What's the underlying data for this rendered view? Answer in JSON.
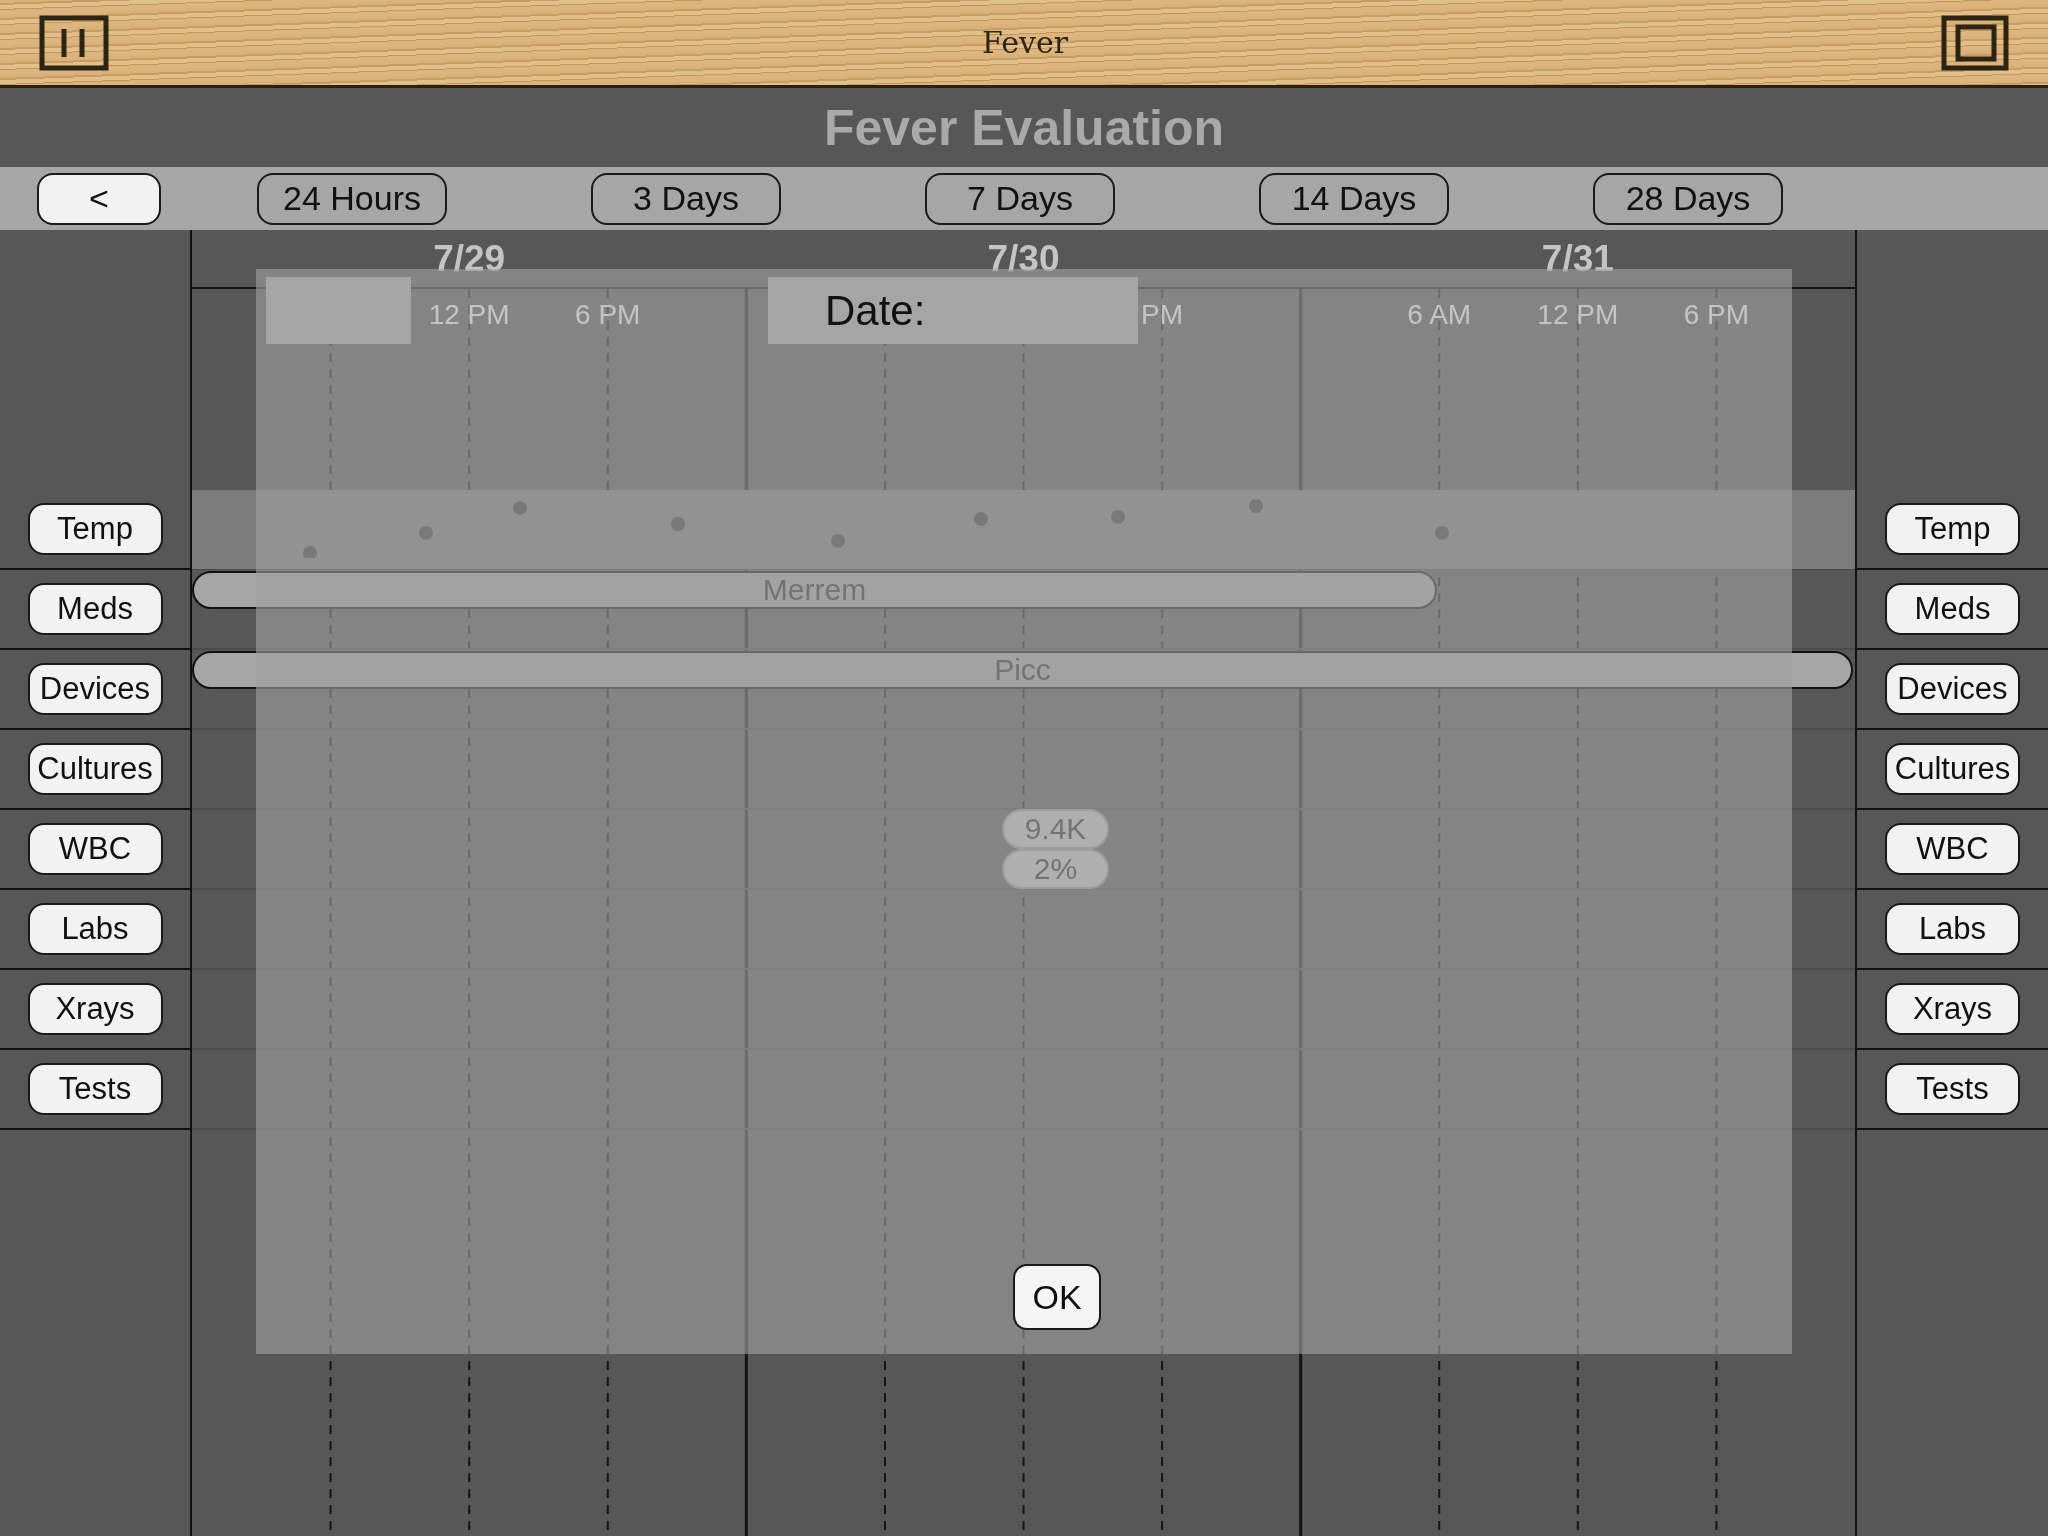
{
  "app": {
    "title": "Fever"
  },
  "heading": "Fever Evaluation",
  "back_button": "<",
  "ranges": [
    {
      "label": "24 Hours"
    },
    {
      "label": "3 Days"
    },
    {
      "label": "7 Days"
    },
    {
      "label": "14 Days"
    },
    {
      "label": "28 Days"
    }
  ],
  "days": [
    {
      "date": "7/29",
      "times": [
        {
          "kind": "noon",
          "text": "12 PM"
        },
        {
          "kind": "evening",
          "text": "6 PM"
        }
      ]
    },
    {
      "date": "7/30",
      "times": [
        {
          "kind": "evening",
          "text": "PM"
        }
      ]
    },
    {
      "date": "7/31",
      "times": [
        {
          "kind": "morning",
          "text": "6 AM"
        },
        {
          "kind": "noon",
          "text": "12 PM"
        },
        {
          "kind": "evening",
          "text": "6 PM"
        }
      ]
    }
  ],
  "left_buttons": [
    "Temp",
    "Meds",
    "Devices",
    "Cultures",
    "WBC",
    "Labs",
    "Xrays",
    "Tests"
  ],
  "right_buttons": [
    "Temp",
    "Meds",
    "Devices",
    "Cultures",
    "WBC",
    "Labs",
    "Xrays",
    "Tests"
  ],
  "rows": [
    {
      "kind": "plot"
    },
    {
      "kind": "bars",
      "bars": [
        {
          "text": "Merrem",
          "kind": "partial"
        }
      ]
    },
    {
      "kind": "bars",
      "bars": [
        {
          "text": "Picc",
          "kind": "full"
        }
      ]
    },
    {
      "kind": "empty"
    },
    {
      "kind": "badges",
      "badges": [
        "9.4K",
        "2%"
      ]
    },
    {
      "kind": "empty"
    },
    {
      "kind": "empty"
    },
    {
      "kind": "empty"
    }
  ],
  "dialog": {
    "label": "Date:",
    "button": "OK"
  }
}
